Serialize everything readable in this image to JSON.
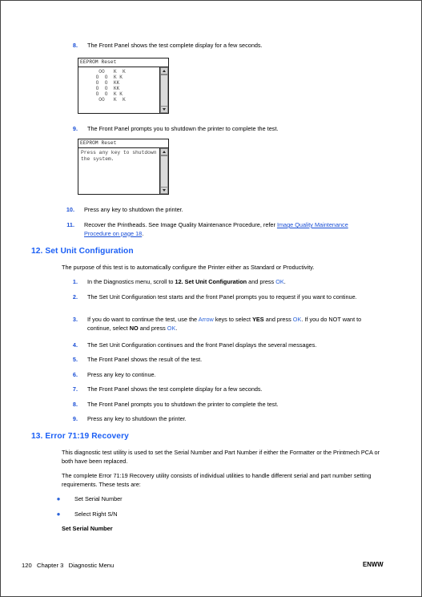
{
  "document": {
    "footer": {
      "page_number": "120",
      "chapter": "Chapter 3",
      "section": "Diagnostic Menu",
      "left_text": "120   Chapter 3   Diagnostic Menu",
      "right_text": "ENWW"
    },
    "colors": {
      "heading_blue": "#1a5ef5",
      "step_number_blue": "#1a4fd6",
      "inline_blue": "#2b63d9",
      "link_blue": "#1a4fd6",
      "page_border": "#444444"
    }
  },
  "top_steps": [
    {
      "num": "8.",
      "text": "The Front Panel shows the test complete display for a few seconds."
    },
    {
      "num": "9.",
      "text": "The Front Panel prompts you to shutdown the printer to complete the test."
    },
    {
      "num": "10.",
      "text": "Press any key to shutdown the printer."
    }
  ],
  "step_11": {
    "num": "11.",
    "text_before": "Recover the Printheads. See Image Quality Maintenance Procedure, refer ",
    "link_text": "Image Quality Maintenance Procedure on page 18",
    "text_after": "."
  },
  "panels": [
    {
      "name": "eeprom-reset-ok-panel",
      "title": "EEPROM Reset",
      "content_type": "ascii-art",
      "ascii_art": "      OO   K  K\n     O  O  K K\n     O  O  KK\n     O  O  KK\n     O  O  K K\n      OO   K  K",
      "scrollbar": true
    },
    {
      "name": "eeprom-reset-shutdown-panel",
      "title": "EEPROM Reset",
      "content_type": "message",
      "message": "Press any key to shutdown\nthe system.",
      "scrollbar": true
    }
  ],
  "section_12": {
    "heading": "12. Set Unit Configuration",
    "intro": "The purpose of this test is to automatically configure the Printer either as Standard or Productivity.",
    "steps": [
      {
        "num": "1.",
        "parts": [
          {
            "t": "In the Diagnostics menu, scroll to ",
            "s": "plain"
          },
          {
            "t": "12. Set Unit Configuration",
            "s": "bold"
          },
          {
            "t": " and press ",
            "s": "plain"
          },
          {
            "t": "OK",
            "s": "blue"
          },
          {
            "t": ".",
            "s": "plain"
          }
        ]
      },
      {
        "num": "2.",
        "parts": [
          {
            "t": "The Set Unit Configuration test starts and the front Panel prompts you to request if you want to continue.",
            "s": "plain"
          }
        ]
      },
      {
        "num": "3.",
        "parts": [
          {
            "t": "If you do want to continue the test, use the ",
            "s": "plain"
          },
          {
            "t": "Arrow",
            "s": "blue"
          },
          {
            "t": " keys to select ",
            "s": "plain"
          },
          {
            "t": "YES",
            "s": "bold"
          },
          {
            "t": " and press ",
            "s": "plain"
          },
          {
            "t": "OK",
            "s": "blue"
          },
          {
            "t": ". If you do NOT want to continue, select ",
            "s": "plain"
          },
          {
            "t": "NO",
            "s": "bold"
          },
          {
            "t": " and press ",
            "s": "plain"
          },
          {
            "t": "OK",
            "s": "blue"
          },
          {
            "t": ".",
            "s": "plain"
          }
        ]
      },
      {
        "num": "4.",
        "parts": [
          {
            "t": "The Set Unit Configuration continues and the front Panel displays the several messages.",
            "s": "plain"
          }
        ]
      },
      {
        "num": "5.",
        "parts": [
          {
            "t": "The Front Panel shows the result of the test.",
            "s": "plain"
          }
        ]
      },
      {
        "num": "6.",
        "parts": [
          {
            "t": "Press any key to continue.",
            "s": "plain"
          }
        ]
      },
      {
        "num": "7.",
        "parts": [
          {
            "t": "The Front Panel shows the test complete display for a few seconds.",
            "s": "plain"
          }
        ]
      },
      {
        "num": "8.",
        "parts": [
          {
            "t": "The Front Panel prompts you to shutdown the printer to complete the test.",
            "s": "plain"
          }
        ]
      },
      {
        "num": "9.",
        "parts": [
          {
            "t": "Press any key to shutdown the printer.",
            "s": "plain"
          }
        ]
      }
    ]
  },
  "section_13": {
    "heading": "13. Error 71:19 Recovery",
    "paragraph_1": "This diagnostic test utility is used to set the Serial Number and Part Number if either the Formatter or the Printmech PCA or both have been replaced.",
    "paragraph_2": "The complete Error 71:19 Recovery utility consists of individual utilities to handle different serial and part number setting requirements. These tests are:",
    "bullets": [
      "Set Serial Number",
      "Select Right S/N"
    ],
    "subheading": "Set Serial Number"
  }
}
